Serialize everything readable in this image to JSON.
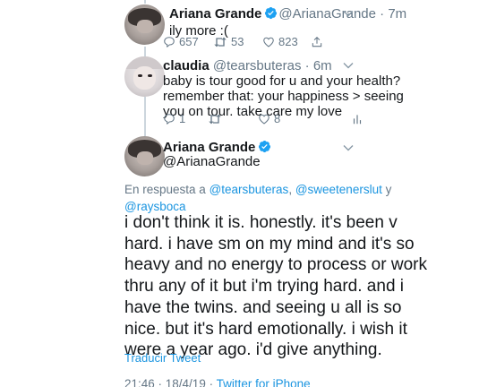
{
  "tweets": [
    {
      "name": "Ariana Grande",
      "handle": "@ArianaGrande",
      "time": "7m",
      "text": "ily more :(",
      "replies": "657",
      "retweets": "53",
      "likes": "823"
    },
    {
      "name": "claudia",
      "handle": "@tearsbuteras",
      "time": "6m",
      "lines": [
        "baby is tour good for u and your health?",
        "remember that: your happiness > seeing",
        "you on tour. take care my love"
      ],
      "replies": "1",
      "retweets": "",
      "likes": "8"
    }
  ],
  "main": {
    "name": "Ariana Grande",
    "handle": "@ArianaGrande",
    "reply_prefix": "En respuesta a ",
    "reply_mention_1": "@tearsbuteras",
    "reply_sep_1": ", ",
    "reply_mention_2": "@sweetenerslut",
    "reply_sep_2": " y",
    "reply_mention_3": "@raysboca",
    "lines": [
      "i don't think it is. honestly. it's been v",
      "hard. i have sm on my mind and it's so",
      "heavy and no energy to process or work",
      "thru any of it but i'm trying hard. and i",
      "have the twins. and seeing u all is so",
      "nice. but it's hard emotionally. i wish it",
      "were a year ago. i'd give anything."
    ],
    "translate": "Traducir Tweet",
    "timestamp": "21:46 · 18/4/19 · ",
    "source": "Twitter for iPhone"
  },
  "colors": {
    "verified": "#1da1f2",
    "link": "#1b95e0",
    "secondary": "#657786",
    "thread": "#ccd6dd"
  }
}
